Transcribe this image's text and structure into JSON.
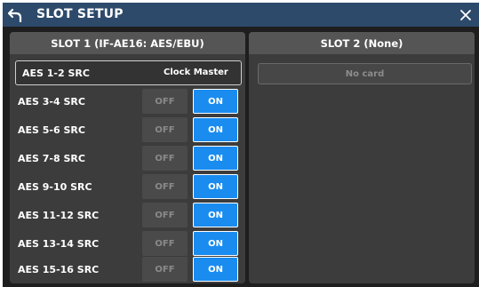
{
  "window": {
    "title": "SLOT SETUP",
    "back_icon": "back-arrow-icon",
    "close_icon": "close-icon"
  },
  "slot1": {
    "header": "SLOT 1 (IF-AE16: AES/EBU)",
    "master_row": {
      "label": "AES 1-2 SRC",
      "value": "Clock Master"
    },
    "rows": [
      {
        "label": "AES 3-4 SRC",
        "off": "OFF",
        "on": "ON"
      },
      {
        "label": "AES 5-6 SRC",
        "off": "OFF",
        "on": "ON"
      },
      {
        "label": "AES 7-8 SRC",
        "off": "OFF",
        "on": "ON"
      },
      {
        "label": "AES 9-10 SRC",
        "off": "OFF",
        "on": "ON"
      },
      {
        "label": "AES 11-12 SRC",
        "off": "OFF",
        "on": "ON"
      },
      {
        "label": "AES 13-14 SRC",
        "off": "OFF",
        "on": "ON"
      },
      {
        "label": "AES 15-16 SRC",
        "off": "OFF",
        "on": "ON"
      }
    ]
  },
  "slot2": {
    "header": "SLOT 2 (None)",
    "status": "No card"
  },
  "colors": {
    "title_bar": "#2d4a6b",
    "background": "#1e1e1e",
    "panel": "#3c3c3c",
    "panel_header": "#555555",
    "on_active": "#1a8cf0",
    "off_inactive": "#4a4a4a"
  }
}
